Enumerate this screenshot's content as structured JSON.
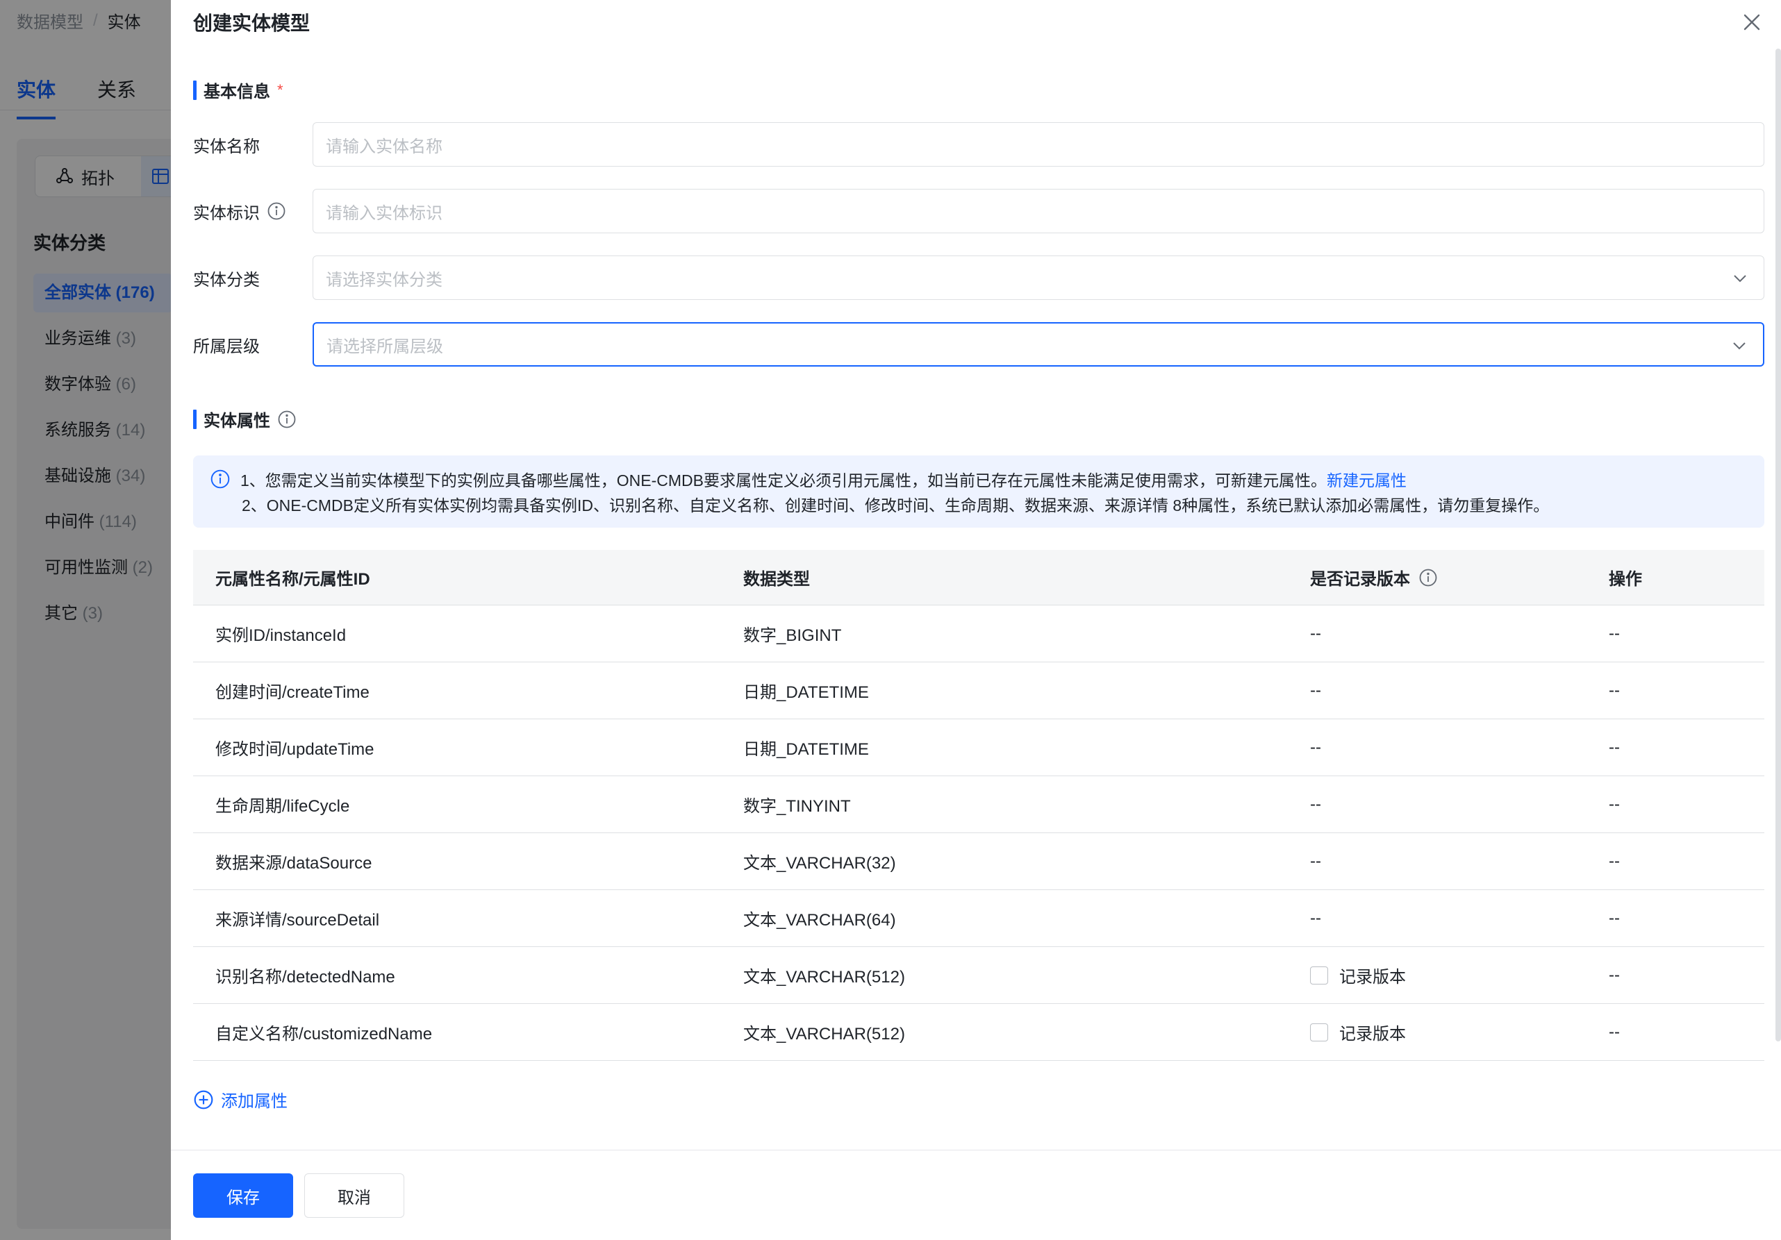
{
  "background": {
    "breadcrumb": [
      "数据模型",
      "实体"
    ],
    "tabs": [
      "实体",
      "关系"
    ],
    "view_switch": {
      "topology_label": "拓扑"
    },
    "category_title": "实体分类",
    "categories": [
      {
        "name": "全部实体",
        "count": "(176)"
      },
      {
        "name": "业务运维",
        "count": "(3)"
      },
      {
        "name": "数字体验",
        "count": "(6)"
      },
      {
        "name": "系统服务",
        "count": "(14)"
      },
      {
        "name": "基础设施",
        "count": "(34)"
      },
      {
        "name": "中间件",
        "count": "(114)"
      },
      {
        "name": "可用性监测",
        "count": "(2)"
      },
      {
        "name": "其它",
        "count": "(3)"
      }
    ]
  },
  "drawer": {
    "title": "创建实体模型",
    "basic_section": {
      "title": "基本信息",
      "required_mark": "*"
    },
    "fields": {
      "name": {
        "label": "实体名称",
        "placeholder": "请输入实体名称"
      },
      "identifier": {
        "label": "实体标识",
        "placeholder": "请输入实体标识"
      },
      "category": {
        "label": "实体分类",
        "placeholder": "请选择实体分类"
      },
      "level": {
        "label": "所属层级",
        "placeholder": "请选择所属层级"
      }
    },
    "attr_section": {
      "title": "实体属性"
    },
    "notice": {
      "line1": "1、您需定义当前实体模型下的实例应具备哪些属性，ONE-CMDB要求属性定义必须引用元属性，如当前已存在元属性未能满足使用需求，可新建元属性。",
      "line1_link": "新建元属性",
      "line2": "2、ONE-CMDB定义所有实体实例均需具备实例ID、识别名称、自定义名称、创建时间、修改时间、生命周期、数据来源、来源详情 8种属性，系统已默认添加必需属性，请勿重复操作。"
    },
    "table": {
      "headers": [
        "元属性名称/元属性ID",
        "数据类型",
        "是否记录版本",
        "操作"
      ],
      "rows": [
        {
          "name": "实例ID/instanceId",
          "type": "数字_BIGINT",
          "version": "--",
          "op": "--"
        },
        {
          "name": "创建时间/createTime",
          "type": "日期_DATETIME",
          "version": "--",
          "op": "--"
        },
        {
          "name": "修改时间/updateTime",
          "type": "日期_DATETIME",
          "version": "--",
          "op": "--"
        },
        {
          "name": "生命周期/lifeCycle",
          "type": "数字_TINYINT",
          "version": "--",
          "op": "--"
        },
        {
          "name": "数据来源/dataSource",
          "type": "文本_VARCHAR(32)",
          "version": "--",
          "op": "--"
        },
        {
          "name": "来源详情/sourceDetail",
          "type": "文本_VARCHAR(64)",
          "version": "--",
          "op": "--"
        },
        {
          "name": "识别名称/detectedName",
          "type": "文本_VARCHAR(512)",
          "version": "记录版本",
          "op": "--"
        },
        {
          "name": "自定义名称/customizedName",
          "type": "文本_VARCHAR(512)",
          "version": "记录版本",
          "op": "--"
        }
      ]
    },
    "add_attr_label": "添加属性",
    "footer": {
      "save_label": "保存",
      "cancel_label": "取消"
    }
  },
  "colors": {
    "primary": "#1664ff",
    "mask": "rgba(0,0,0,0.45)",
    "required": "#f54a45",
    "notice_bg": "#eef3ff"
  }
}
